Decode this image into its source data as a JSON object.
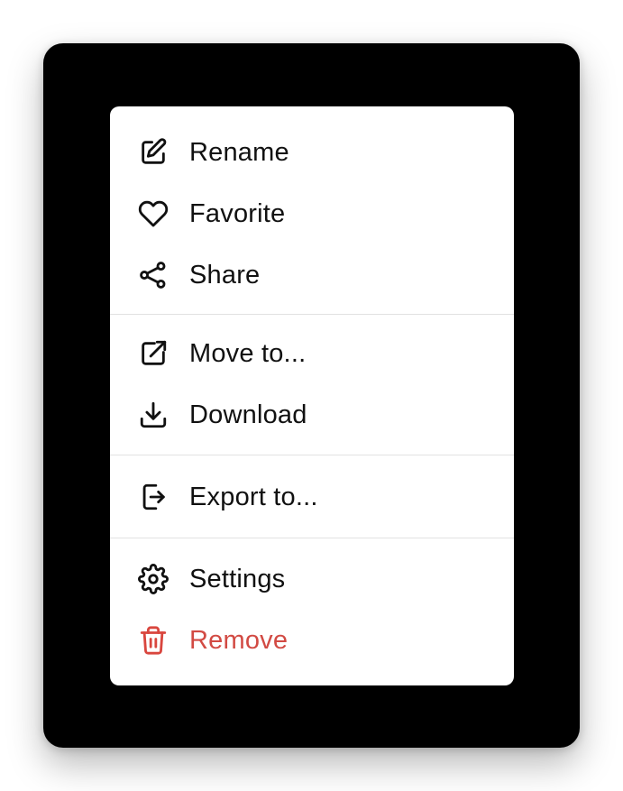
{
  "menu": {
    "groups": [
      {
        "items": [
          {
            "label": "Rename",
            "icon": "pencil-square-icon"
          },
          {
            "label": "Favorite",
            "icon": "heart-icon"
          },
          {
            "label": "Share",
            "icon": "share-icon"
          }
        ]
      },
      {
        "items": [
          {
            "label": "Move to...",
            "icon": "external-link-icon"
          },
          {
            "label": "Download",
            "icon": "download-icon"
          }
        ]
      },
      {
        "items": [
          {
            "label": "Export to...",
            "icon": "export-icon"
          }
        ]
      },
      {
        "items": [
          {
            "label": "Settings",
            "icon": "gear-icon"
          },
          {
            "label": "Remove",
            "icon": "trash-icon"
          }
        ]
      }
    ]
  },
  "colors": {
    "backdrop": "#000000",
    "menu_background": "#ffffff",
    "text": "#111111",
    "danger": "#d24a43",
    "divider": "#e2e2e2"
  }
}
